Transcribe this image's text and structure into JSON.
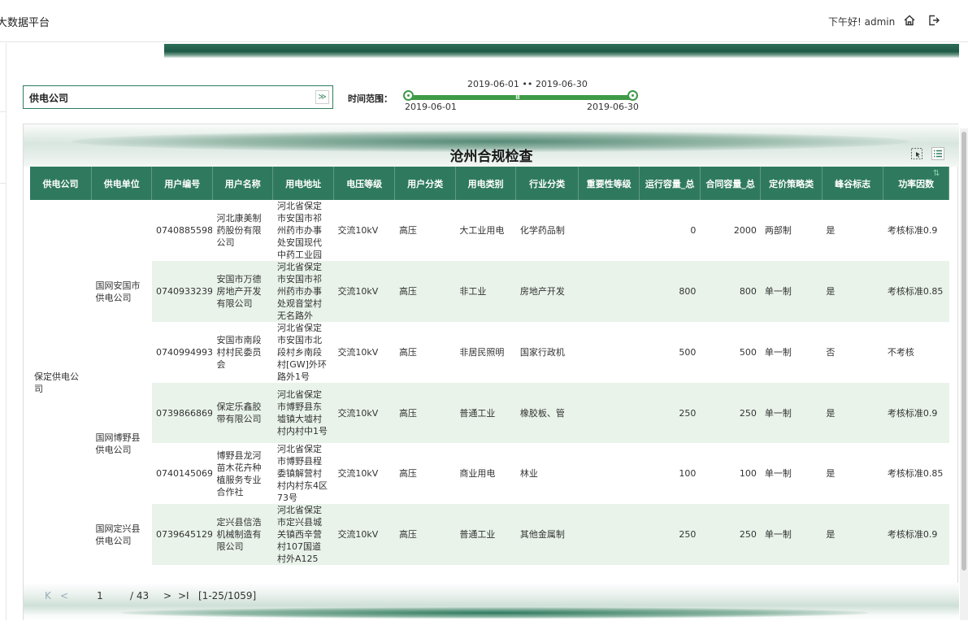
{
  "app": {
    "title": "大数据平台"
  },
  "header": {
    "greeting": "下午好! admin"
  },
  "filter": {
    "company_value": "供电公司",
    "range_label": "时间范围：",
    "range_top": "2019-06-01 •• 2019-06-30",
    "range_start": "2019-06-01",
    "range_end": "2019-06-30",
    "grip": "III"
  },
  "report": {
    "title": "沧州合规检查",
    "columns": [
      "供电公司",
      "供电单位",
      "用户编号",
      "用户名称",
      "用电地址",
      "电压等级",
      "用户分类",
      "用电类别",
      "行业分类",
      "重要性等级",
      "运行容量_总",
      "合同容量_总",
      "定价策略类",
      "峰谷标志",
      "功率因数"
    ],
    "company_cell": "保定供电公司",
    "units": [
      "国网安国市供电公司",
      "国网博野县供电公司",
      "国网定兴县供电公司"
    ],
    "rows": [
      {
        "id": "0740885598",
        "name": "河北康美制药股份有限公司",
        "addr": "河北省保定市安国市祁州药市办事处安国现代中药工业园",
        "voltage": "交流10kV",
        "ucat": "高压",
        "etype": "大工业用电",
        "industry": "化学药品制",
        "importance": "",
        "run": "0",
        "contract": "2000",
        "pricing": "两部制",
        "peak": "是",
        "pf": "考核标准0.9"
      },
      {
        "id": "0740933239",
        "name": "安国市万德房地产开发有限公司",
        "addr": "河北省保定市安国市祁州药市办事处观音堂村无名路外",
        "voltage": "交流10kV",
        "ucat": "高压",
        "etype": "非工业",
        "industry": "房地产开发",
        "importance": "",
        "run": "800",
        "contract": "800",
        "pricing": "单一制",
        "peak": "是",
        "pf": "考核标准0.85"
      },
      {
        "id": "0740994993",
        "name": "安国市南段村村民委员会",
        "addr": "河北省保定市安国市北段村乡南段村[GW]外环路外1号",
        "voltage": "交流10kV",
        "ucat": "高压",
        "etype": "非居民照明",
        "industry": "国家行政机",
        "importance": "",
        "run": "500",
        "contract": "500",
        "pricing": "单一制",
        "peak": "否",
        "pf": "不考核"
      },
      {
        "id": "0739866869",
        "name": "保定乐鑫胶带有限公司",
        "addr": "河北省保定市博野县东墟镇大墟村村内村中1号",
        "voltage": "交流10kV",
        "ucat": "高压",
        "etype": "普通工业",
        "industry": "橡胶板、管",
        "importance": "",
        "run": "250",
        "contract": "250",
        "pricing": "单一制",
        "peak": "是",
        "pf": "考核标准0.9"
      },
      {
        "id": "0740145069",
        "name": "博野县龙河苗木花卉种植服务专业合作社",
        "addr": "河北省保定市博野县程委镇解营村村内村东4区73号",
        "voltage": "交流10kV",
        "ucat": "高压",
        "etype": "商业用电",
        "industry": "林业",
        "importance": "",
        "run": "100",
        "contract": "100",
        "pricing": "单一制",
        "peak": "是",
        "pf": "考核标准0.85"
      },
      {
        "id": "0739645129",
        "name": "定兴县信浩机械制造有限公司",
        "addr": "河北省保定市定兴县城关镇西辛营村107国道村外A125",
        "voltage": "交流10kV",
        "ucat": "高压",
        "etype": "普通工业",
        "industry": "其他金属制",
        "importance": "",
        "run": "250",
        "contract": "250",
        "pricing": "单一制",
        "peak": "是",
        "pf": "考核标准0.9"
      }
    ]
  },
  "pager": {
    "first": "K",
    "prev": "<",
    "page": "1",
    "total": "/ 43",
    "next": ">",
    "last": ">I",
    "range": "[1-25/1059]"
  },
  "colors": {
    "accent": "#2f7a5f",
    "row_alt": "#e9f3ea",
    "slider": "#3e9a46"
  }
}
